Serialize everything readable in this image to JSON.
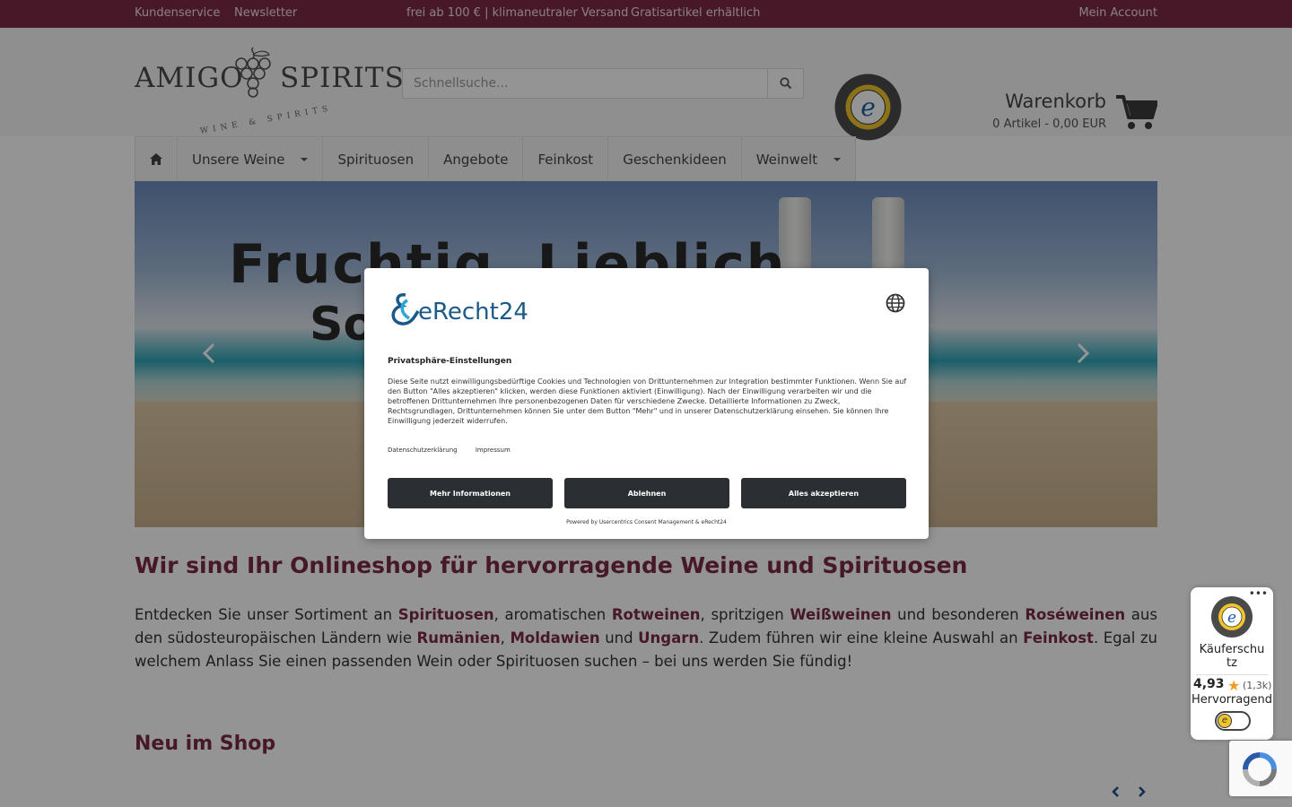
{
  "topbar": {
    "left_links": [
      "Kundenservice",
      "Newsletter"
    ],
    "promo_1": "frei ab 100 € | klimaneutraler Versand",
    "promo_2": "Gratisartikel erhältlich",
    "account": "Mein Account"
  },
  "header": {
    "logo_left": "AMIGO",
    "logo_right": "SPIRITS",
    "logo_sub": "WINE & SPIRITS",
    "search_placeholder": "Schnellsuche...",
    "cart_title": "Warenkorb",
    "cart_info": "0 Artikel - 0,00 EUR"
  },
  "nav": {
    "items": [
      {
        "label": "Unsere Weine",
        "dropdown": true
      },
      {
        "label": "Spirituosen",
        "dropdown": false
      },
      {
        "label": "Angebote",
        "dropdown": false
      },
      {
        "label": "Feinkost",
        "dropdown": false
      },
      {
        "label": "Geschenkideen",
        "dropdown": false
      },
      {
        "label": "Weinwelt",
        "dropdown": true
      }
    ]
  },
  "hero": {
    "line1": "Fruchtig, Lieblich",
    "line2": "So"
  },
  "main": {
    "heading": "Wir sind Ihr Onlineshop für hervorragende Weine und Spirituosen",
    "p_parts": [
      "Entdecken Sie unser Sortiment an ",
      "Spirituosen",
      ", aromatischen ",
      "Rotweinen",
      ", spritzigen ",
      "Weißweinen",
      " und besonderen ",
      "Roséweinen",
      " aus den südosteuropäischen Ländern wie ",
      "Rumänien",
      ", ",
      "Moldawien",
      " und ",
      "Ungarn",
      ". Zudem führen wir eine kleine Auswahl an ",
      "Feinkost",
      ". Egal zu welchem Anlass Sie einen passenden Wein oder Spirituosen suchen – bei uns werden Sie fündig!"
    ],
    "new_heading": "Neu im Shop"
  },
  "consent": {
    "brand": "eRecht24",
    "title": "Privatsphäre-Einstellungen",
    "description": "Diese Seite nutzt einwilligungsbedürftige Cookies und Technologien von Drittunternehmen zur Integration bestimmter Funktionen. Wenn Sie auf den Button \"Alles akzeptieren\" klicken, werden diese Funktionen aktiviert (Einwilligung). Nach der Einwilligung verarbeiten wir und die betroffenen Drittunternehmen Ihre personenbezogenen Daten für verschiedene Zwecke. Detaillierte Informationen zu Zweck, Rechtsgrundlagen, Drittunternehmen können Sie unter dem Button \"Mehr\" und in unserer Datenschutzerklärung einsehen. Sie können Ihre Einwilligung jederzeit widerrufen.",
    "link_privacy": "Datenschutzerklärung",
    "link_imprint": "Impressum",
    "btn_more": "Mehr Informationen",
    "btn_decline": "Ablehnen",
    "btn_accept": "Alles akzeptieren",
    "powered": "Powered by Usercentrics Consent Management & eRecht24"
  },
  "trusted_widget": {
    "label": "Käuferschutz",
    "score": "4,93",
    "count": "(1,3k)",
    "rating": "Hervorragend"
  },
  "colors": {
    "brand": "#7a2b45",
    "button_dark": "#2b2e33",
    "star": "#f29a26"
  }
}
